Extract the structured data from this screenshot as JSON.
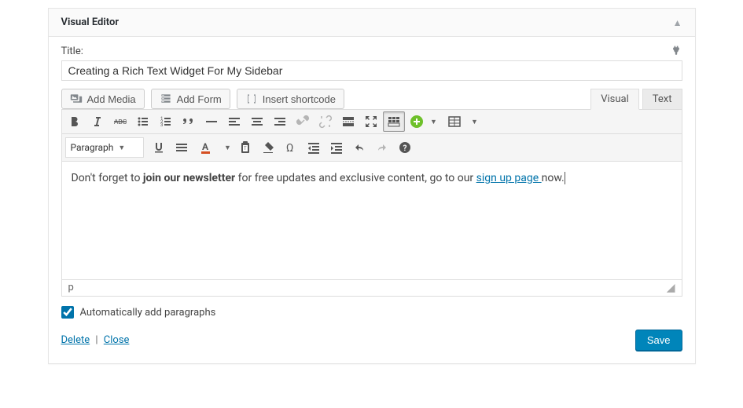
{
  "header": {
    "title": "Visual Editor"
  },
  "title": {
    "label": "Title:",
    "value": "Creating a Rich Text Widget For My Sidebar"
  },
  "media_buttons": {
    "add_media": "Add Media",
    "add_form": "Add Form",
    "insert_shortcode": "Insert shortcode"
  },
  "tabs": {
    "visual": "Visual",
    "text": "Text",
    "active": "visual"
  },
  "format": {
    "selected": "Paragraph"
  },
  "content": {
    "before_bold": "Don't forget to ",
    "bold": "join our newsletter",
    "after_bold": " for free updates and exclusive content, go to our ",
    "link": "sign up page ",
    "after_link": "now."
  },
  "status": {
    "path": "p"
  },
  "autop": {
    "label": "Automatically add paragraphs",
    "checked": true
  },
  "footer": {
    "delete": "Delete",
    "close": "Close",
    "save": "Save"
  }
}
